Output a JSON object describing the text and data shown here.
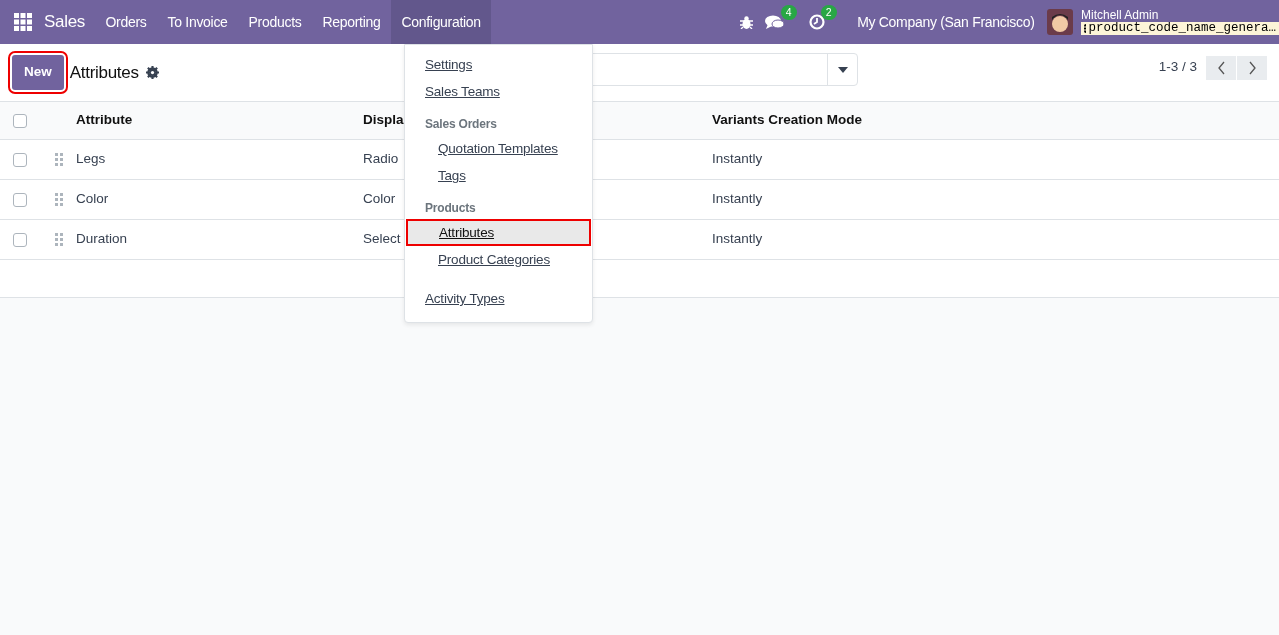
{
  "navbar": {
    "app": "Sales",
    "menus": [
      {
        "label": "Orders",
        "open": false
      },
      {
        "label": "To Invoice",
        "open": false
      },
      {
        "label": "Products",
        "open": false
      },
      {
        "label": "Reporting",
        "open": false
      },
      {
        "label": "Configuration",
        "open": true
      }
    ],
    "messages_count": "4",
    "activities_count": "2",
    "company": "My Company (San Francisco)",
    "user": "Mitchell Admin",
    "database": "product_code_name_genera…"
  },
  "control_panel": {
    "new_button": {
      "label": "New",
      "highlighted": true
    },
    "title": "Attributes",
    "pager": "1-3 / 3"
  },
  "table": {
    "select_all_checked": false,
    "columns": [
      "Attribute",
      "Displa",
      "Variants Creation Mode"
    ],
    "rows": [
      {
        "checked": false,
        "cells": [
          "Legs",
          "Radio",
          "Instantly"
        ]
      },
      {
        "checked": false,
        "cells": [
          "Color",
          "Color",
          "Instantly"
        ]
      },
      {
        "checked": false,
        "cells": [
          "Duration",
          "Select",
          "Instantly"
        ]
      }
    ]
  },
  "dropdown": [
    {
      "kind": "item",
      "label": "Settings",
      "highlighted": false
    },
    {
      "kind": "item",
      "label": "Sales Teams",
      "highlighted": false
    },
    {
      "kind": "header",
      "label": "Sales Orders"
    },
    {
      "kind": "subitem",
      "label": "Quotation Templates",
      "highlighted": false
    },
    {
      "kind": "subitem",
      "label": "Tags",
      "highlighted": false
    },
    {
      "kind": "header",
      "label": "Products"
    },
    {
      "kind": "subitem",
      "label": "Attributes",
      "highlighted": true
    },
    {
      "kind": "subitem",
      "label": "Product Categories",
      "highlighted": false
    },
    {
      "kind": "item",
      "label": "Activity Types",
      "highlighted": false,
      "gap": true
    }
  ]
}
